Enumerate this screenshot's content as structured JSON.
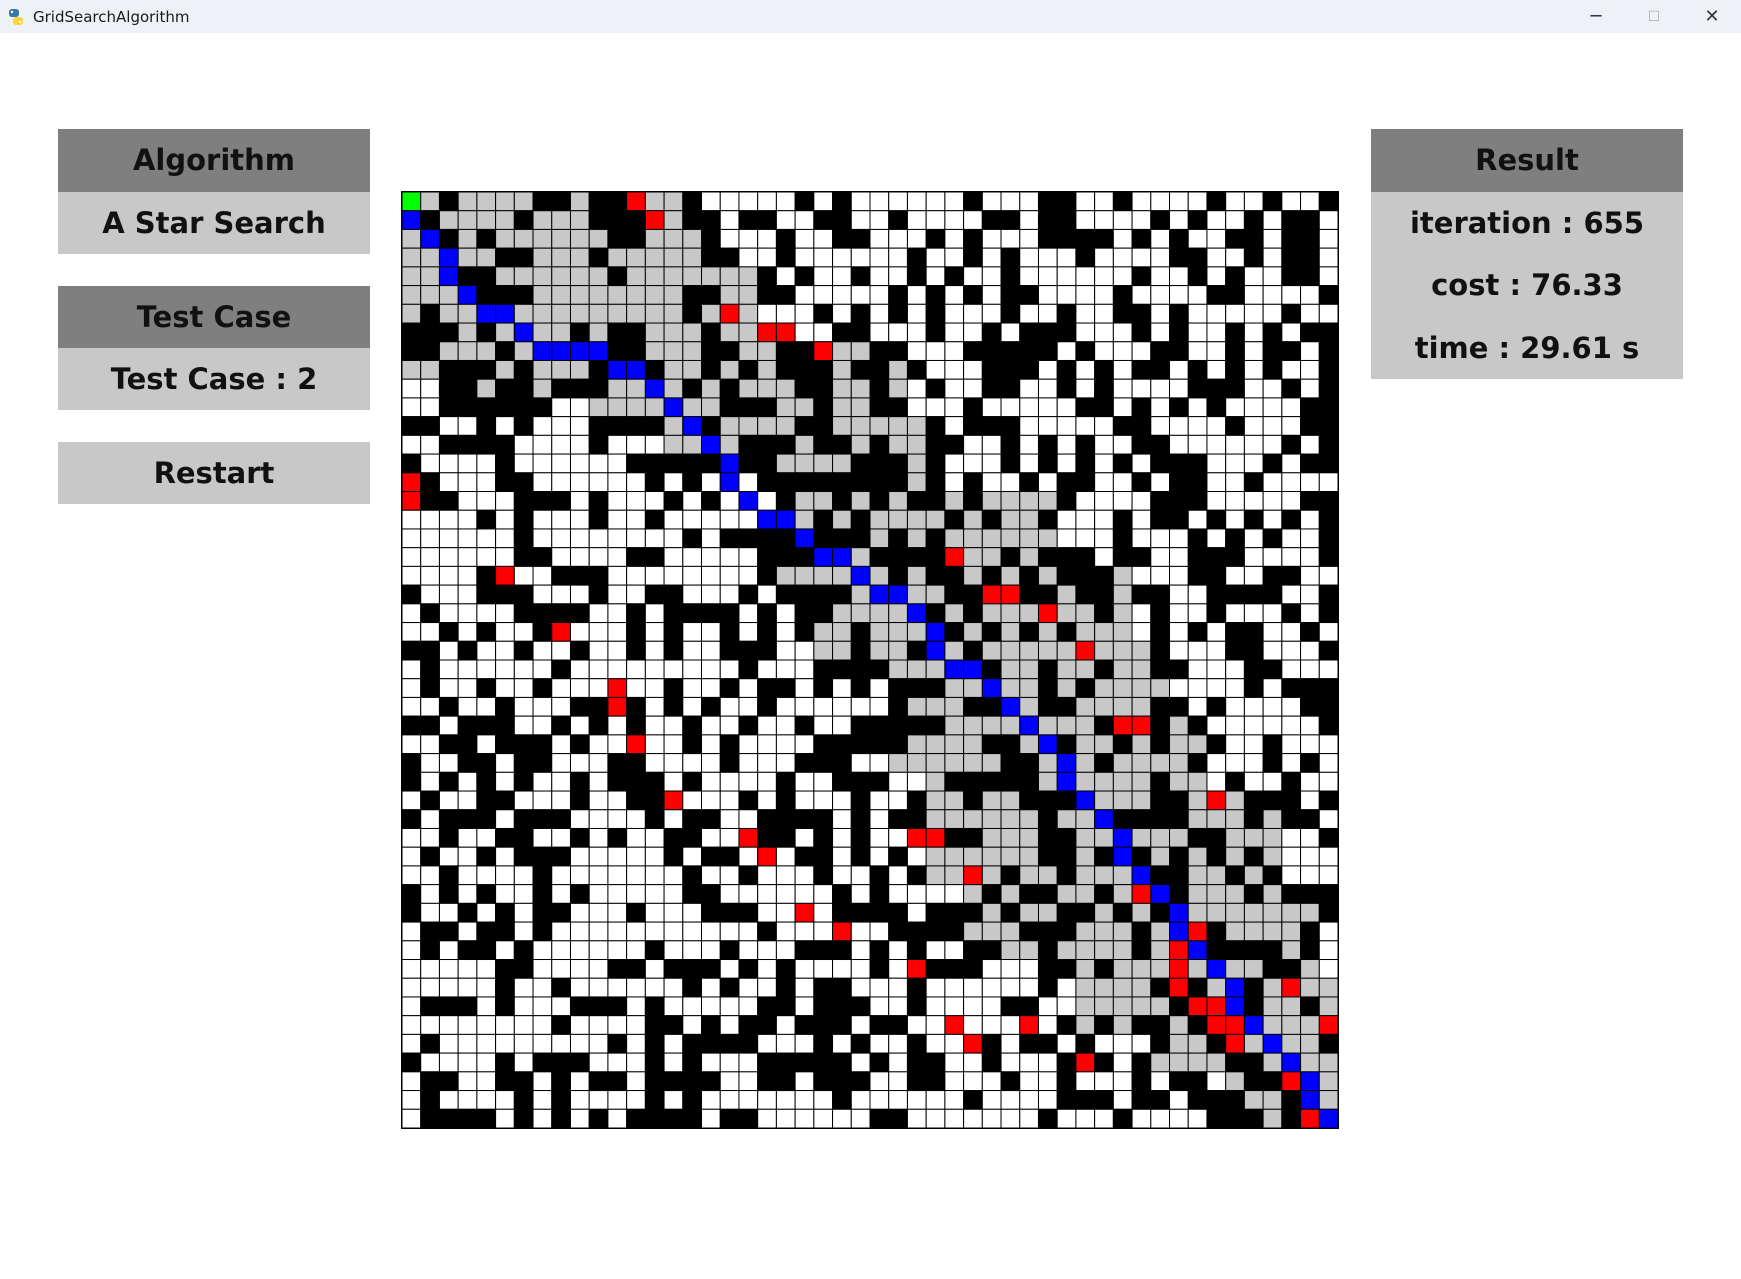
{
  "window": {
    "title": "GridSearchAlgorithm",
    "icon": "python-icon",
    "controls": {
      "minimize": "─",
      "maximize": "☐",
      "close": "✕"
    }
  },
  "algorithm": {
    "header": "Algorithm",
    "value": "A Star Search"
  },
  "test_case": {
    "header": "Test Case",
    "value": "Test Case : 2"
  },
  "restart": {
    "label": "Restart"
  },
  "result": {
    "header": "Result",
    "iteration": "iteration : 655",
    "cost": "cost : 76.33",
    "time": "time : 29.61 s"
  },
  "colors": {
    "wall": "#000000",
    "free": "#ffffff",
    "visited": "#c8c8c8",
    "frontier": "#ff0000",
    "path": "#0000ff",
    "start": "#00ff00",
    "panel_header": "#7f7f7f",
    "panel_body": "#c8c8c8"
  },
  "grid": {
    "rows": 50,
    "cols": 50,
    "start": [
      0,
      0
    ],
    "goal": [
      49,
      49
    ],
    "path": [
      [
        0,
        0
      ],
      [
        1,
        0
      ],
      [
        2,
        1
      ],
      [
        3,
        2
      ],
      [
        4,
        2
      ],
      [
        5,
        3
      ],
      [
        6,
        4
      ],
      [
        6,
        5
      ],
      [
        7,
        6
      ],
      [
        8,
        7
      ],
      [
        8,
        8
      ],
      [
        8,
        9
      ],
      [
        8,
        10
      ],
      [
        9,
        11
      ],
      [
        9,
        12
      ],
      [
        10,
        13
      ],
      [
        11,
        14
      ],
      [
        12,
        15
      ],
      [
        13,
        16
      ],
      [
        14,
        17
      ],
      [
        15,
        17
      ],
      [
        16,
        18
      ],
      [
        17,
        19
      ],
      [
        17,
        20
      ],
      [
        18,
        21
      ],
      [
        19,
        22
      ],
      [
        19,
        23
      ],
      [
        20,
        24
      ],
      [
        21,
        25
      ],
      [
        21,
        26
      ],
      [
        22,
        27
      ],
      [
        23,
        28
      ],
      [
        24,
        28
      ],
      [
        25,
        29
      ],
      [
        25,
        30
      ],
      [
        26,
        31
      ],
      [
        27,
        32
      ],
      [
        28,
        33
      ],
      [
        29,
        34
      ],
      [
        30,
        35
      ],
      [
        31,
        35
      ],
      [
        32,
        36
      ],
      [
        33,
        37
      ],
      [
        34,
        38
      ],
      [
        35,
        38
      ],
      [
        36,
        39
      ],
      [
        37,
        40
      ],
      [
        38,
        41
      ],
      [
        39,
        41
      ],
      [
        40,
        42
      ],
      [
        41,
        43
      ],
      [
        42,
        44
      ],
      [
        43,
        44
      ],
      [
        44,
        45
      ],
      [
        45,
        46
      ],
      [
        46,
        47
      ],
      [
        47,
        48
      ],
      [
        48,
        48
      ],
      [
        49,
        49
      ]
    ],
    "frontier": [
      [
        0,
        12
      ],
      [
        1,
        13
      ],
      [
        6,
        17
      ],
      [
        7,
        19
      ],
      [
        7,
        20
      ],
      [
        8,
        22
      ],
      [
        15,
        0
      ],
      [
        16,
        0
      ],
      [
        19,
        29
      ],
      [
        20,
        5
      ],
      [
        21,
        31
      ],
      [
        21,
        32
      ],
      [
        22,
        34
      ],
      [
        23,
        8
      ],
      [
        24,
        36
      ],
      [
        26,
        11
      ],
      [
        27,
        11
      ],
      [
        28,
        38
      ],
      [
        28,
        39
      ],
      [
        29,
        12
      ],
      [
        32,
        14
      ],
      [
        32,
        43
      ],
      [
        34,
        18
      ],
      [
        35,
        19
      ],
      [
        34,
        27
      ],
      [
        34,
        28
      ],
      [
        36,
        30
      ],
      [
        37,
        39
      ],
      [
        38,
        21
      ],
      [
        39,
        23
      ],
      [
        39,
        42
      ],
      [
        40,
        41
      ],
      [
        41,
        27
      ],
      [
        41,
        41
      ],
      [
        41,
        43
      ],
      [
        42,
        41
      ],
      [
        42,
        47
      ],
      [
        43,
        42
      ],
      [
        43,
        43
      ],
      [
        44,
        29
      ],
      [
        44,
        33
      ],
      [
        44,
        43
      ],
      [
        44,
        44
      ],
      [
        44,
        49
      ],
      [
        45,
        30
      ],
      [
        45,
        44
      ],
      [
        46,
        36
      ],
      [
        47,
        47
      ],
      [
        49,
        48
      ]
    ],
    "visited_regions": [
      [
        0,
        0,
        9,
        15
      ],
      [
        1,
        4,
        10,
        12
      ],
      [
        4,
        10,
        12,
        18
      ],
      [
        8,
        14,
        14,
        26
      ],
      [
        12,
        20,
        20,
        28
      ],
      [
        16,
        22,
        24,
        34
      ],
      [
        20,
        26,
        30,
        38
      ],
      [
        24,
        28,
        36,
        40
      ],
      [
        28,
        30,
        40,
        42
      ],
      [
        32,
        36,
        44,
        46
      ],
      [
        38,
        40,
        46,
        48
      ],
      [
        42,
        44,
        49,
        49
      ]
    ],
    "seed": 20240613
  }
}
